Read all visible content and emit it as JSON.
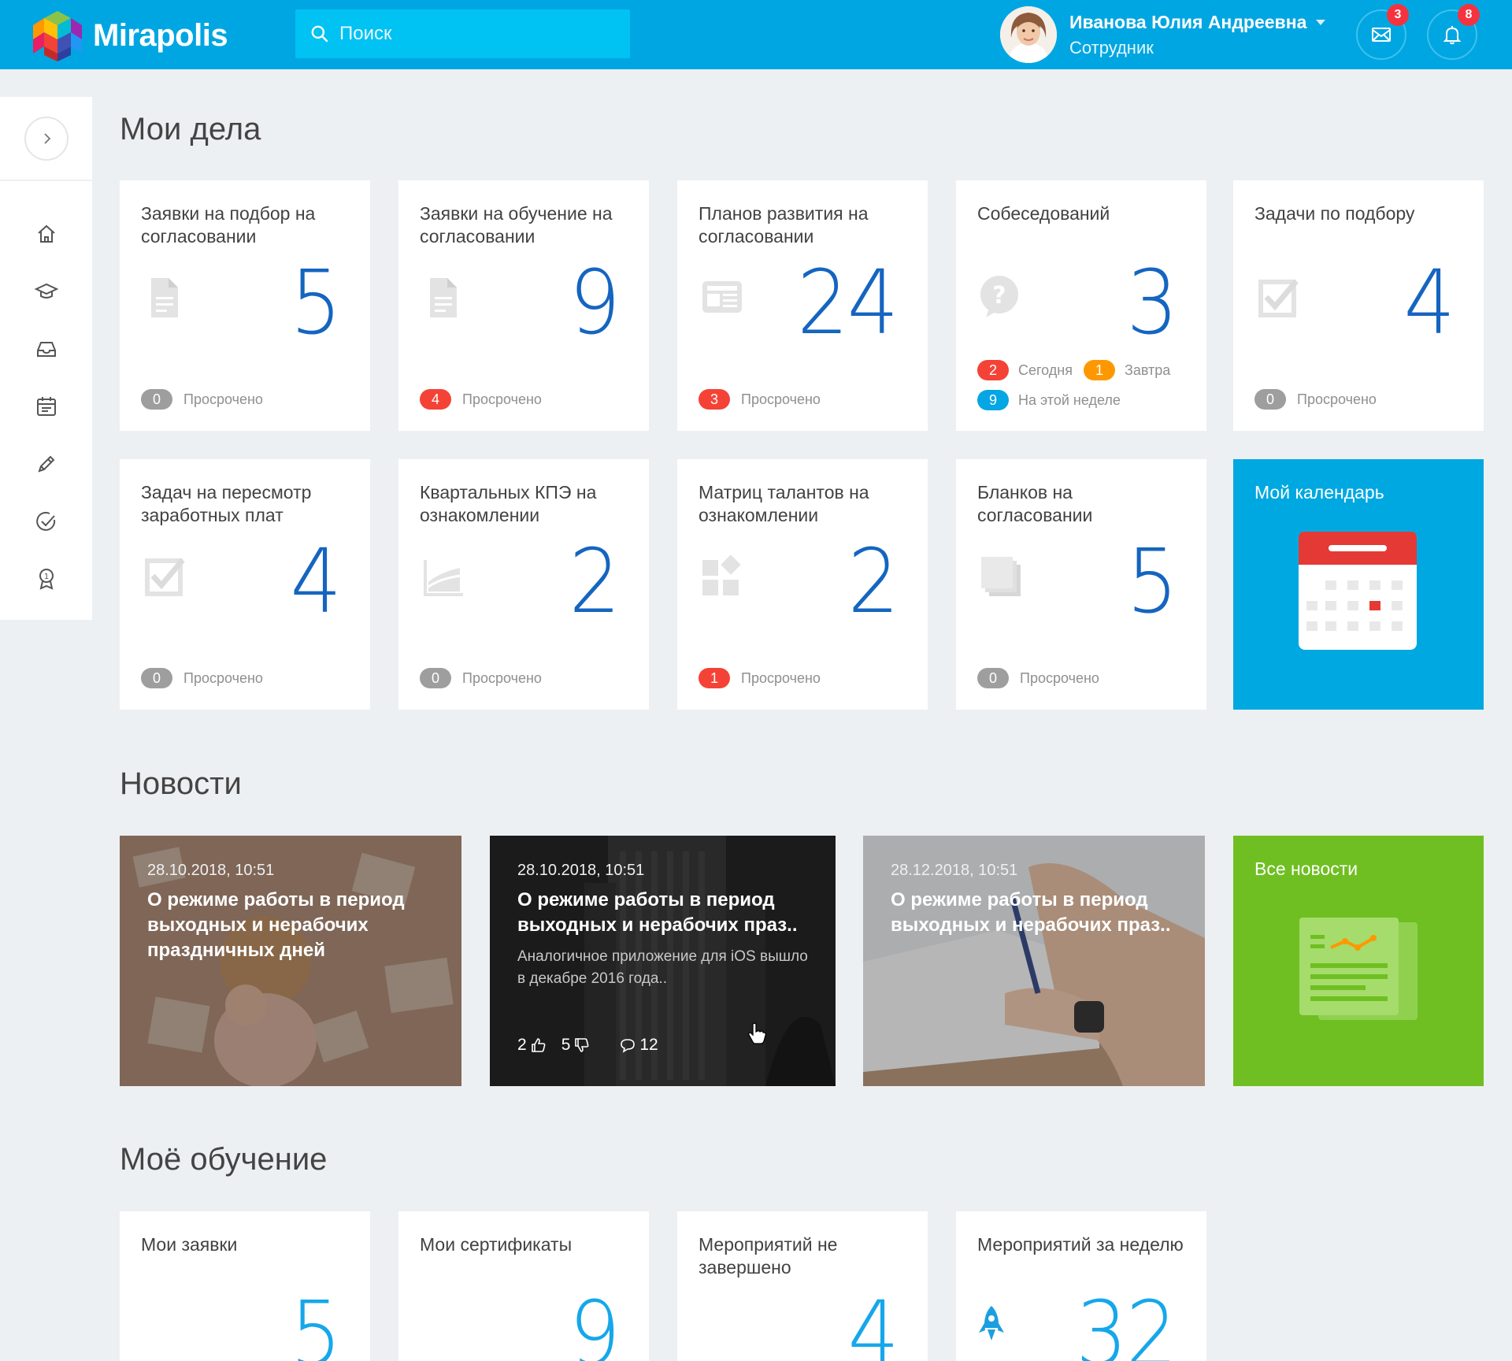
{
  "header": {
    "logo_text": "Mirapolis",
    "search_placeholder": "Поиск",
    "user_name": "Иванова Юлия Андреевна",
    "user_role": "Сотрудник",
    "messages_count": "3",
    "notifications_count": "8"
  },
  "sidebar": {
    "items": [
      "home-icon",
      "graduation-cap-icon",
      "inbox-icon",
      "calendar-icon",
      "pencil-icon",
      "check-circle-icon",
      "award-icon"
    ]
  },
  "sections": {
    "my_tasks": "Мои дела",
    "news": "Новости",
    "my_learning": "Моё обучение"
  },
  "tasks": [
    {
      "title": "Заявки на подбор на согласовании",
      "value": "5",
      "overdue_count": "0",
      "overdue_label": "Просрочено"
    },
    {
      "title": "Заявки на обучение на согласовании",
      "value": "9",
      "overdue_count": "4",
      "overdue_label": "Просрочено"
    },
    {
      "title": "Планов развития на согласовании",
      "value": "24",
      "overdue_count": "3",
      "overdue_label": "Просрочено"
    },
    {
      "title": "Собеседований",
      "value": "3",
      "today_count": "2",
      "today_label": "Сегодня",
      "tomorrow_count": "1",
      "tomorrow_label": "Завтра",
      "week_count": "9",
      "week_label": "На этой неделе"
    },
    {
      "title": "Задачи по подбору",
      "value": "4",
      "overdue_count": "0",
      "overdue_label": "Просрочено"
    },
    {
      "title": "Задач на пересмотр заработных плат",
      "value": "4",
      "overdue_count": "0",
      "overdue_label": "Просрочено"
    },
    {
      "title": "Квартальных КПЭ на ознакомлении",
      "value": "2",
      "overdue_count": "0",
      "overdue_label": "Просрочено"
    },
    {
      "title": "Матриц талантов на ознакомлении",
      "value": "2",
      "overdue_count": "1",
      "overdue_label": "Просрочено"
    },
    {
      "title": "Бланков на согласовании",
      "value": "5",
      "overdue_count": "0",
      "overdue_label": "Просрочено"
    }
  ],
  "calendar_tile": {
    "title": "Мой календарь"
  },
  "news": [
    {
      "date": "28.10.2018, 10:51",
      "title": "О режиме работы в период выходных и нерабочих праздничных дней"
    },
    {
      "date": "28.10.2018, 10:51",
      "title": "О режиме работы в период выходных и нерабочих праз..",
      "excerpt": "Аналогичное приложение для iOS вышло в декабре 2016 года..",
      "likes": "2",
      "dislikes": "5",
      "comments": "12"
    },
    {
      "date": "28.12.2018, 10:51",
      "title": "О режиме работы в период выходных и нерабочих праз.."
    }
  ],
  "all_news_tile": {
    "title": "Все новости"
  },
  "learning": [
    {
      "title": "Мои заявки",
      "value": "5"
    },
    {
      "title": "Мои сертификаты",
      "value": "9"
    },
    {
      "title": "Мероприятий не завершено",
      "value": "4"
    },
    {
      "title": "Мероприятий за неделю",
      "value": "32"
    }
  ],
  "colors": {
    "header": "#00a6e1",
    "accent_blue": "#1565c0",
    "calendar_tile": "#00a8e1",
    "news_tile": "#6fbf22",
    "overdue_red": "#f44336"
  }
}
